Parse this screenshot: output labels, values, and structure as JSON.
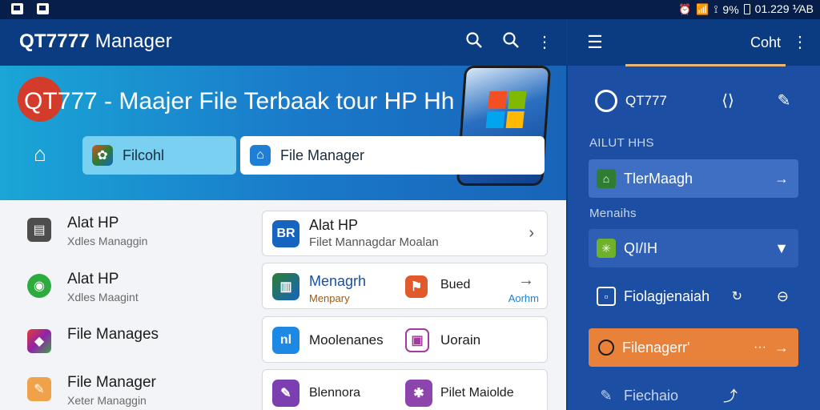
{
  "status_bar": {
    "time": "01.229 ⅟AB",
    "battery": "9%"
  },
  "app_bar": {
    "title_bold": "QT7777",
    "title_rest": " Manager",
    "icons": [
      "search-icon",
      "search-icon",
      "more-vert-icon"
    ]
  },
  "hero": {
    "title": "QT777 - Maajer File Terbaak tour HP Hh",
    "chips": [
      {
        "label": "Filcohl",
        "icon": "app-icon"
      },
      {
        "label": "File Manager",
        "icon": "home-icon"
      }
    ]
  },
  "list": [
    {
      "title": "Alat HP",
      "subtitle": "Xdles Managgin",
      "icon": "clipboard-icon"
    },
    {
      "title": "Alat HP",
      "subtitle": "Xdles Maagint",
      "icon": "chat-icon"
    },
    {
      "title": "File Manages",
      "subtitle": "",
      "icon": "cube-icon"
    },
    {
      "title": "File Manager",
      "subtitle": "Xeter Managgin",
      "icon": "edit-icon"
    }
  ],
  "cards": [
    {
      "title": "Alat HP",
      "subtitle": "Filet Mannagdar Moalan",
      "icon_text": "BR"
    },
    {
      "left_title": "Menagrh",
      "left_sub": "Menpary",
      "right_title": "Bued",
      "right_sub": "Aorhm"
    },
    {
      "left_title": "Moolenanes",
      "right_title": "Uorain",
      "icon_text": "nl"
    },
    {
      "left_title": "Blennora",
      "right_title": "Pilet Maiolde"
    }
  ],
  "right_panel": {
    "title": "Coht",
    "brand": "QT777",
    "section1": "AILUT HHS",
    "row1": "TlerMaagh",
    "section2": "Menaihs",
    "row2": "QI/IH",
    "row3": "Fiolagjenaiah",
    "row4": "Filenagerr'",
    "row4_dots": "···",
    "row5": "Fiechaio"
  },
  "colors": {
    "primary_dark": "#0b3b80",
    "panel_blue": "#1c4ea3",
    "accent_orange": "#e8813a",
    "accent_sand": "#e9b879"
  }
}
